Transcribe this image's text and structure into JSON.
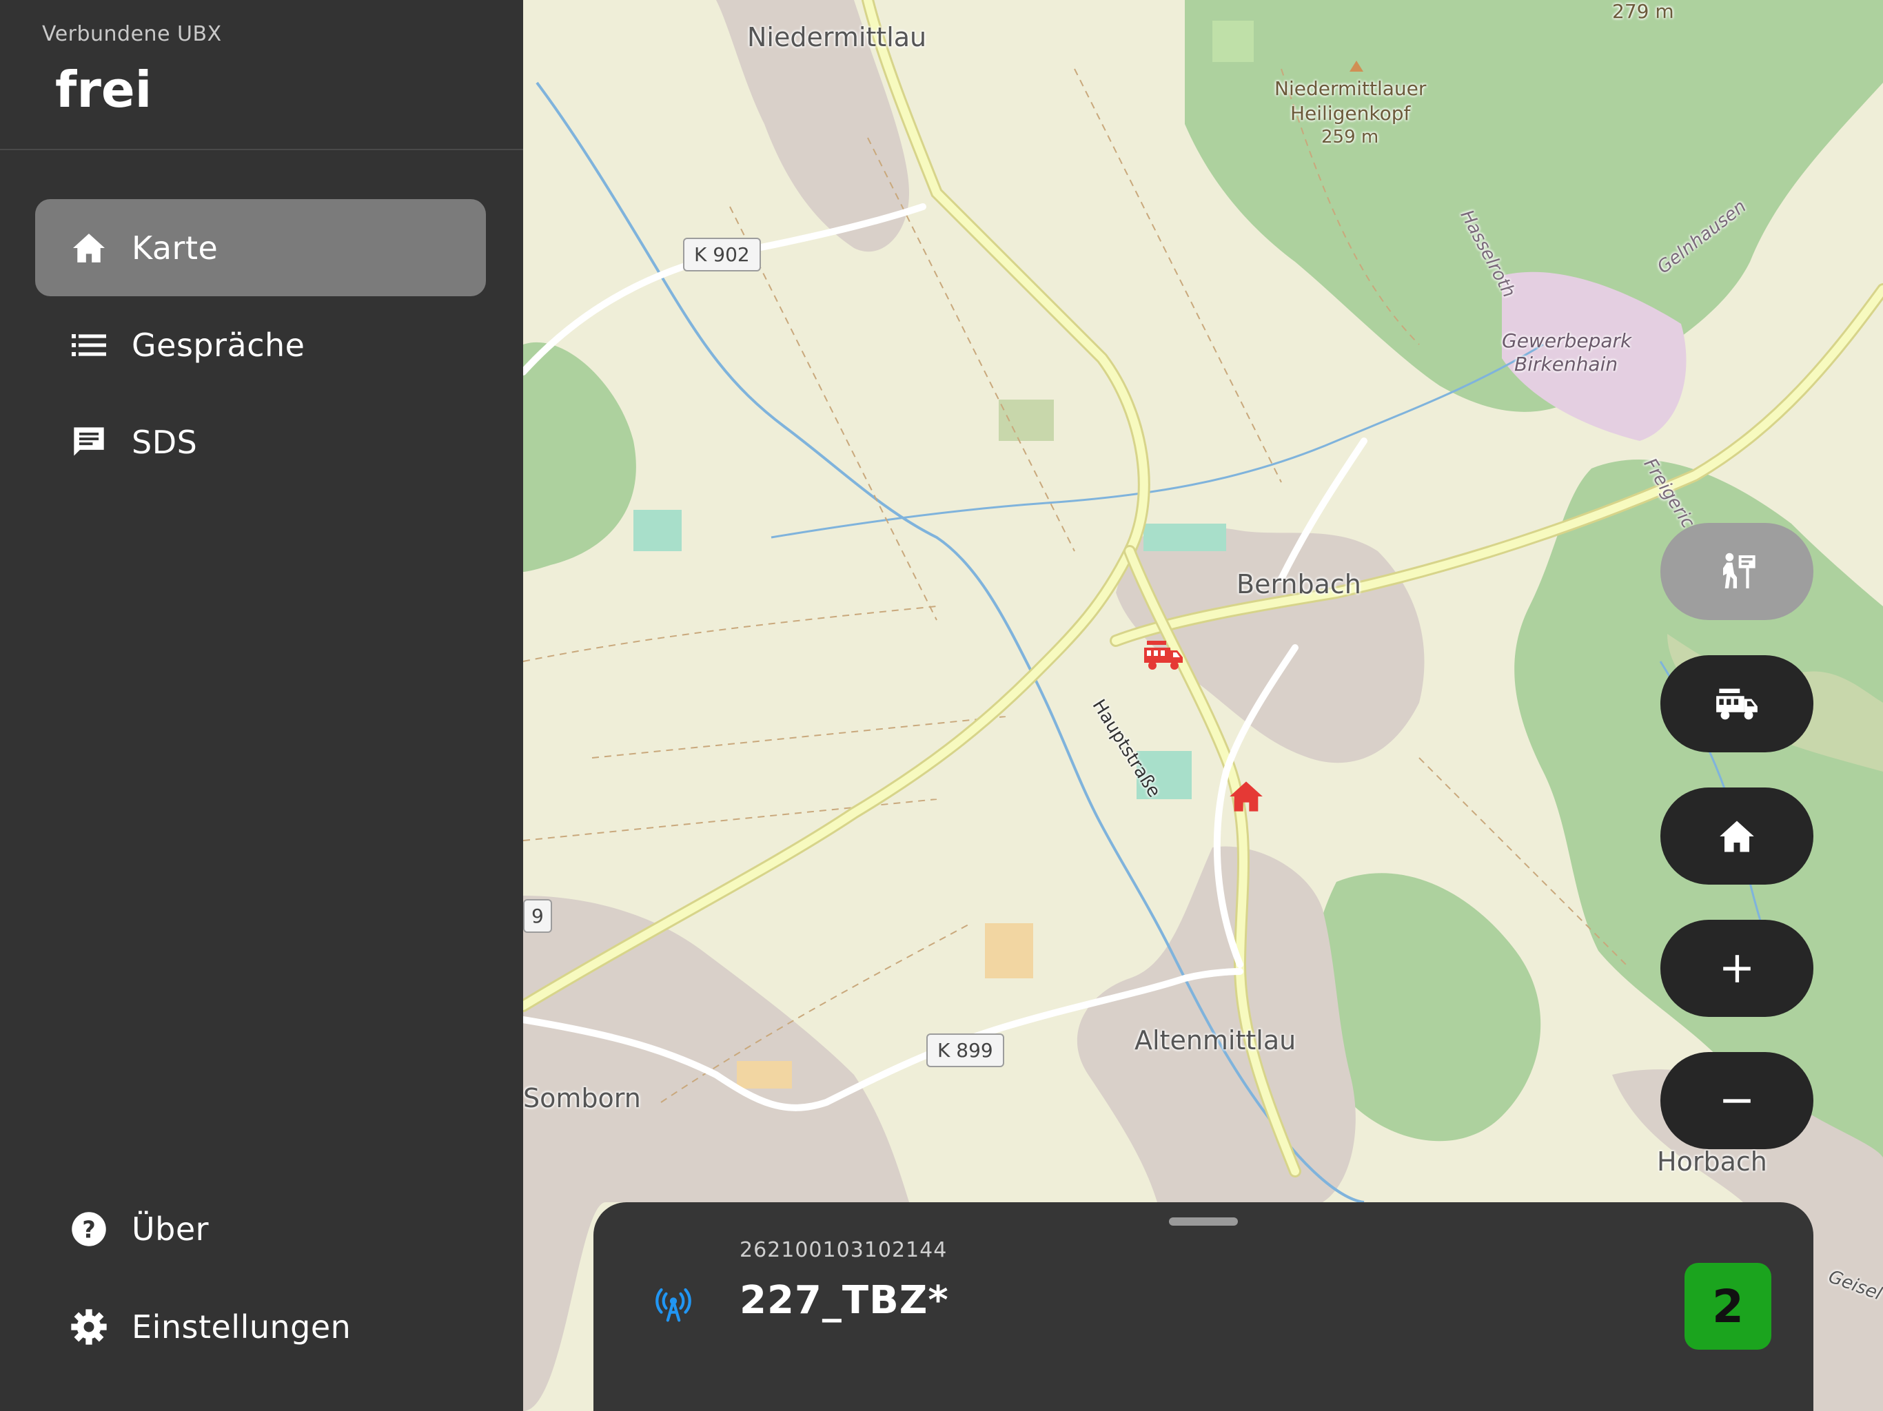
{
  "sidebar": {
    "subtitle": "Verbundene UBX",
    "status": "frei",
    "nav": [
      {
        "label": "Karte",
        "icon": "home-icon",
        "active": true
      },
      {
        "label": "Gespräche",
        "icon": "list-icon"
      },
      {
        "label": "SDS",
        "icon": "message-icon"
      }
    ],
    "bottom": [
      {
        "label": "Über",
        "icon": "help-icon"
      },
      {
        "label": "Einstellungen",
        "icon": "gear-icon"
      }
    ]
  },
  "map": {
    "labels": {
      "niedermittlau": "Niedermittlau",
      "heiligenkopf": "Niedermittlauer",
      "heiligenkopf2": "Heiligenkopf",
      "heiligenkopf_alt": "259 m",
      "peak_alt": "279 m",
      "hasselroth": "Hasselroth",
      "gelnhausen": "Gelnhausen",
      "gewerbepark": "Gewerbepark",
      "birkenhain": "Birkenhain",
      "freigericht": "Freigeric",
      "bernbach": "Bernbach",
      "hauptstrasse": "Hauptstraße",
      "altenmittlau": "Altenmittlau",
      "somborn": "Somborn",
      "horbach": "Horbach",
      "geisel": "Geisel",
      "edge9": "9"
    },
    "shields": {
      "k902": "K 902",
      "k899": "K 899"
    },
    "markers": {
      "fire_truck": "fire-truck-icon",
      "station": "home-icon"
    },
    "buttons": [
      {
        "icon": "person-sign-icon",
        "style": "light"
      },
      {
        "icon": "fire-truck-icon",
        "style": "dark"
      },
      {
        "icon": "home-icon",
        "style": "dark"
      },
      {
        "icon": "plus-icon",
        "style": "dark"
      },
      {
        "icon": "minus-icon",
        "style": "dark"
      }
    ],
    "colors": {
      "forest": "#add19e",
      "land": "#efeed8",
      "urban": "#d9d0c9",
      "road": "#f7fabf",
      "marker": "#e53935"
    }
  },
  "sheet": {
    "id": "262100103102144",
    "name": "227_TBZ*",
    "badge": "2",
    "antenna_icon": "antenna-icon",
    "colors": {
      "badge": "#1ba41e",
      "antenna": "#2196f3"
    }
  }
}
